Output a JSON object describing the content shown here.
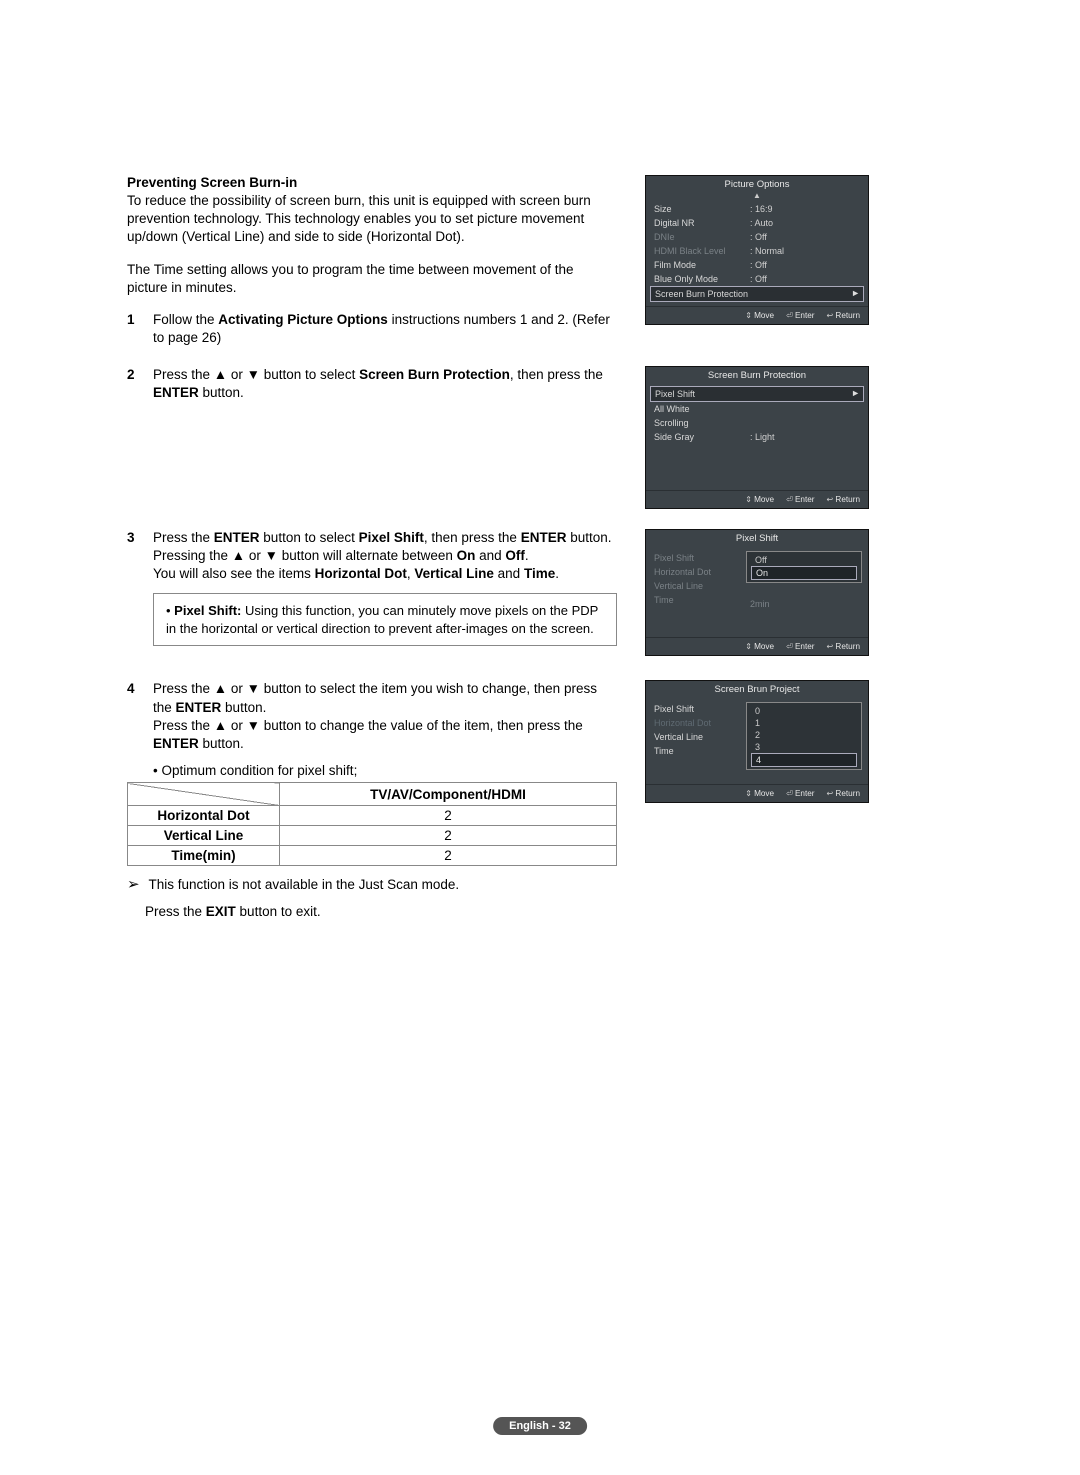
{
  "heading": "Preventing Screen Burn-in",
  "intro1": "To reduce the possibility of screen burn, this unit is equipped with screen burn prevention technology. This technology enables you to set picture movement up/down (Vertical Line) and side to side (Horizontal Dot).",
  "intro2": "The Time setting allows you to program the time between movement of the picture in minutes.",
  "step1": {
    "pre": "Follow the ",
    "bold": "Activating Picture Options",
    "post": " instructions numbers 1 and 2. (Refer to page 26)"
  },
  "step2": {
    "s1a": "Press the ▲ or ▼ button to select ",
    "s1b": "Screen Burn Protection",
    "s1c": ", then press the ",
    "s1d": "ENTER",
    "s1e": " button."
  },
  "step3": {
    "l1a": "Press the ",
    "l1b": "ENTER",
    "l1c": " button to select ",
    "l1d": "Pixel Shift",
    "l1e": ", then press the ",
    "l1f": "ENTER",
    "l1g": " button.",
    "l2a": "Pressing the ▲ or ▼ button will alternate between ",
    "l2b": "On",
    "l2c": " and ",
    "l2d": "Off",
    "l2e": ".",
    "l3a": "You will also see the items ",
    "l3b": "Horizontal Dot",
    "l3c": ", ",
    "l3d": "Vertical Line",
    "l3e": " and ",
    "l3f": "Time",
    "l3g": "."
  },
  "note3": {
    "bold": "Pixel Shift:",
    "text": " Using this function, you can minutely move pixels on the PDP in the horizontal or vertical direction to prevent after-images on the screen."
  },
  "step4": {
    "l1a": "Press the ▲ or ▼ button to select the item you wish to change, then press the ",
    "l1b": "ENTER",
    "l1c": " button.",
    "l2a": "Press the ▲ or ▼ button to change the value of the item, then press the ",
    "l2b": "ENTER",
    "l2c": " button."
  },
  "bullet4": "Optimum condition for pixel shift;",
  "table": {
    "colhead": "TV/AV/Component/HDMI",
    "rows": [
      {
        "label": "Horizontal Dot",
        "value": "2"
      },
      {
        "label": "Vertical Line",
        "value": "2"
      },
      {
        "label": "Time(min)",
        "value": "2"
      }
    ]
  },
  "postnote": "This function is not available in the Just Scan mode.",
  "postexit_a": "Press the ",
  "postexit_b": "EXIT",
  "postexit_c": " button to exit.",
  "footer": "English - 32",
  "osd_foot": {
    "move": "Move",
    "enter": "Enter",
    "return": "Return"
  },
  "osd1": {
    "title": "Picture Options",
    "rows": [
      {
        "lab": "Size",
        "val": ": 16:9"
      },
      {
        "lab": "Digital NR",
        "val": ": Auto"
      },
      {
        "lab": "DNIe",
        "val": ": Off",
        "dim": true
      },
      {
        "lab": "HDMI Black Level",
        "val": ": Normal",
        "dim": true
      },
      {
        "lab": "Film Mode",
        "val": ": Off"
      },
      {
        "lab": "Blue Only Mode",
        "val": ": Off"
      }
    ],
    "hl": "Screen Burn Protection"
  },
  "osd2": {
    "title": "Screen Burn Protection",
    "hl": "Pixel Shift",
    "rows": [
      {
        "lab": "All White"
      },
      {
        "lab": "Scrolling"
      },
      {
        "lab": "Side Gray",
        "val": ": Light"
      }
    ]
  },
  "osd3": {
    "title": "Pixel Shift",
    "left": [
      {
        "lab": "Pixel Shift"
      },
      {
        "lab": "Horizontal Dot"
      },
      {
        "lab": "Vertical Line"
      },
      {
        "lab": "Time"
      }
    ],
    "opts": [
      "Off",
      "On"
    ],
    "right_extra": "2min"
  },
  "osd4": {
    "title": "Screen Brun Project",
    "left": [
      {
        "lab": "Pixel Shift"
      },
      {
        "lab": "Horizontal Dot",
        "dimtxt": true
      },
      {
        "lab": "Vertical Line"
      },
      {
        "lab": "Time"
      }
    ],
    "opts": [
      "0",
      "1",
      "2",
      "3",
      "4"
    ]
  }
}
